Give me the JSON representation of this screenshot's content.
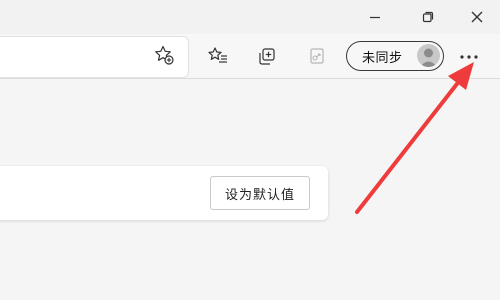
{
  "window": {
    "minimize_icon": "minimize-icon",
    "maximize_icon": "restore-icon",
    "close_icon": "close-icon"
  },
  "toolbar": {
    "favorite_star_icon": "add-favorite-star-icon",
    "favorites_icon": "favorites-list-icon",
    "collections_icon": "collections-icon",
    "share_icon": "share-icon",
    "more_icon": "more-options-icon"
  },
  "profile": {
    "label": "未同步",
    "avatar_icon": "avatar-icon"
  },
  "settings_card": {
    "set_default_label": "设为默认值"
  },
  "annotation": {
    "arrow_color": "#ee3b3b"
  }
}
